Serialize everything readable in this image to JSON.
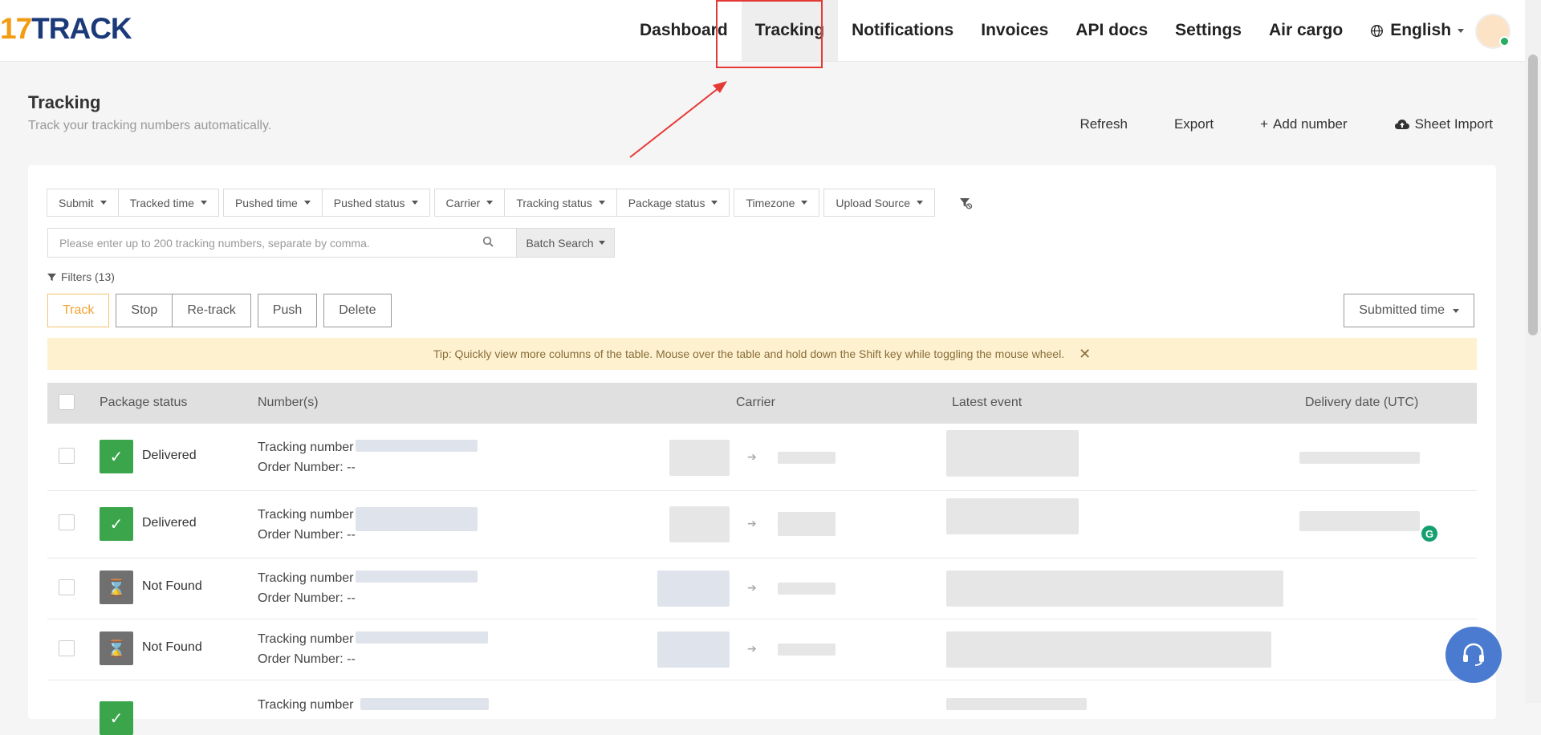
{
  "header": {
    "logo_num": "17",
    "logo_text": "TRACK",
    "nav": [
      "Dashboard",
      "Tracking",
      "Notifications",
      "Invoices",
      "API docs",
      "Settings",
      "Air cargo"
    ],
    "active_nav": "Tracking",
    "language": "English"
  },
  "page": {
    "title": "Tracking",
    "subtitle": "Track your tracking numbers automatically.",
    "actions": {
      "refresh": "Refresh",
      "export": "Export",
      "add_number": "Add number",
      "sheet_import": "Sheet Import"
    }
  },
  "filters": {
    "group1": [
      "Submit",
      "Tracked time"
    ],
    "group2": [
      "Pushed time",
      "Pushed status"
    ],
    "group3": [
      "Carrier",
      "Tracking status",
      "Package status"
    ],
    "group4": [
      "Timezone"
    ],
    "group5": [
      "Upload Source"
    ]
  },
  "search": {
    "placeholder": "Please enter up to 200 tracking numbers, separate by comma.",
    "batch_label": "Batch Search"
  },
  "filters_count": "Filters (13)",
  "buttons": {
    "track": "Track",
    "stop": "Stop",
    "retrack": "Re-track",
    "push": "Push",
    "delete": "Delete"
  },
  "sort": {
    "label": "Submitted time"
  },
  "tip": "Tip: Quickly view more columns of the table. Mouse over the table and hold down the Shift key while toggling the mouse wheel.",
  "table": {
    "columns": [
      "Package status",
      "Number(s)",
      "Carrier",
      "Latest event",
      "Delivery date (UTC)"
    ],
    "rows": [
      {
        "status": "Delivered",
        "type": "ok",
        "tracking_label": "Tracking number",
        "order_label": "Order Number: --"
      },
      {
        "status": "Delivered",
        "type": "ok",
        "tracking_label": "Tracking number",
        "order_label": "Order Number: --"
      },
      {
        "status": "Not Found",
        "type": "nf",
        "tracking_label": "Tracking number",
        "order_label": "Order Number: --"
      },
      {
        "status": "Not Found",
        "type": "nf",
        "tracking_label": "Tracking number",
        "order_label": "Order Number: --"
      },
      {
        "status": "",
        "type": "ok",
        "tracking_label": "Tracking number",
        "order_label": ""
      }
    ]
  },
  "colors": {
    "accent": "#f0a331",
    "delivered": "#3aa54a",
    "not_found": "#707070",
    "annotation": "#e53935",
    "support": "#4a7bd0"
  },
  "icons": [
    "globe-icon",
    "bell-icon",
    "cloud-upload-icon",
    "plus-icon",
    "search-icon",
    "funnel-clear-icon",
    "check-icon",
    "hourglass-icon",
    "headset-icon"
  ]
}
